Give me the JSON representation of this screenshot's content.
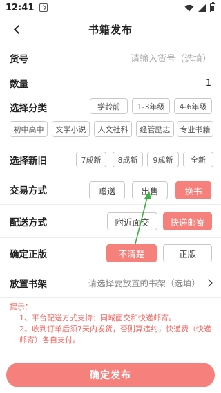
{
  "status_bar": {
    "time": "12:41"
  },
  "nav": {
    "title": "书籍发布"
  },
  "item_no": {
    "label": "货号",
    "placeholder": "请输入货号（选填）"
  },
  "quantity": {
    "label": "数量",
    "value": "1"
  },
  "category": {
    "label": "选择分类",
    "options": [
      "学龄前",
      "1-3年级",
      "4-6年级",
      "初中高中",
      "文学小说",
      "人文社科",
      "经管励志",
      "专业书籍"
    ]
  },
  "condition": {
    "label": "选择新旧",
    "options": [
      "7成新",
      "8成新",
      "9成新",
      "全新"
    ]
  },
  "trade": {
    "label": "交易方式",
    "options": [
      "赠送",
      "出售",
      "换书"
    ],
    "selected": "换书"
  },
  "delivery": {
    "label": "配送方式",
    "options": [
      "附近面交",
      "快递邮寄"
    ],
    "selected": "快递邮寄"
  },
  "authentic": {
    "label": "确定正版",
    "options": [
      "不清楚",
      "正版"
    ],
    "selected": "不清楚"
  },
  "shelf": {
    "label": "放置书架",
    "placeholder": "请选择要放置的书架（选填）"
  },
  "tips": {
    "title": "提示：",
    "line1": "1、平台配送方式支持：同城面交和快递邮寄。",
    "line2": "2、收到订单后须7天内发货，否则算违约，快递费（快递邮寄）各自支付。"
  },
  "submit": {
    "label": "确定发布"
  },
  "colors": {
    "accent": "#f6807b",
    "annotation_arrow": "#3cb043"
  }
}
